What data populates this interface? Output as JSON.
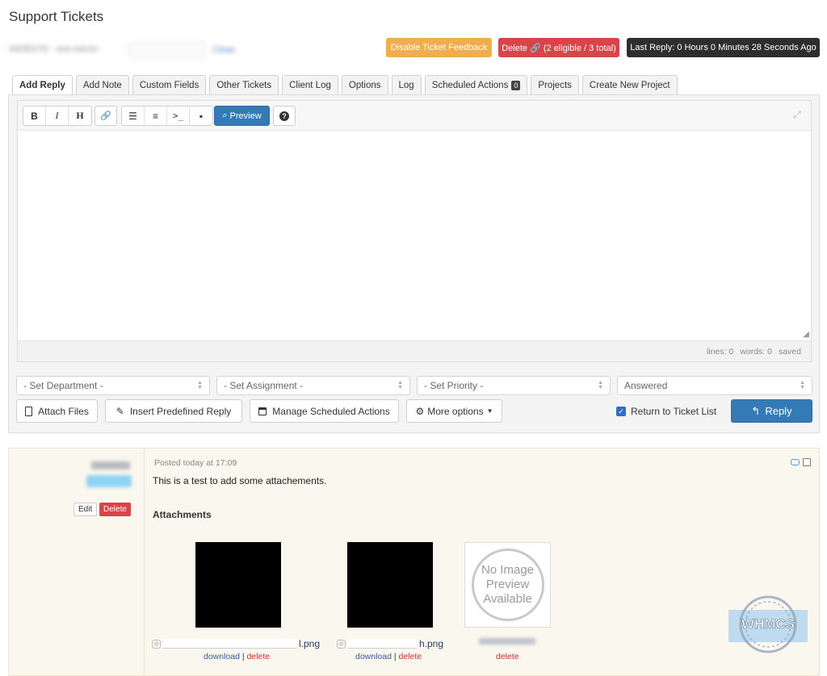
{
  "header": {
    "page_title": "Support Tickets",
    "client_blurred": "WEBSITE - test Admin",
    "status_select": "Answered",
    "close_link": "Close",
    "btn_disable_feedback": "Disable Ticket Feedback",
    "btn_delete": "Delete 🔗 (2 eligible / 3 total)",
    "last_reply": "Last Reply: 0 Hours 0 Minutes 28 Seconds Ago"
  },
  "tabs": [
    {
      "label": "Add Reply",
      "active": true
    },
    {
      "label": "Add Note"
    },
    {
      "label": "Custom Fields"
    },
    {
      "label": "Other Tickets"
    },
    {
      "label": "Client Log"
    },
    {
      "label": "Options"
    },
    {
      "label": "Log"
    },
    {
      "label": "Scheduled Actions",
      "count": "0"
    },
    {
      "label": "Projects"
    },
    {
      "label": "Create New Project"
    }
  ],
  "editor": {
    "bold": "B",
    "italic": "I",
    "heading": "H",
    "link": "🔗",
    "preview": "Preview",
    "help": "?",
    "lines": "lines: 0",
    "words": "words: 0",
    "saved": "saved"
  },
  "selects": {
    "department": "- Set Department -",
    "assignment": "- Set Assignment -",
    "priority": "- Set Priority -",
    "status": "Answered"
  },
  "actions": {
    "attach_files": "Attach Files",
    "insert_predefined": "Insert Predefined Reply",
    "manage_scheduled": "Manage Scheduled Actions",
    "more_options": "More options",
    "return_to_list": "Return to Ticket List",
    "reply": "Reply"
  },
  "message": {
    "posted": "Posted today at 17:09",
    "body": "This is a test to add some attachements.",
    "edit": "Edit",
    "delete": "Delete",
    "attachments_title": "Attachments",
    "attachments": [
      {
        "name_suffix": "l.png",
        "download": "download",
        "delete": "delete"
      },
      {
        "name_suffix": "h.png",
        "download": "download",
        "delete": "delete"
      },
      {
        "preview": "No Image Preview Available",
        "delete": "delete"
      }
    ]
  },
  "watermark": "WHMCS"
}
